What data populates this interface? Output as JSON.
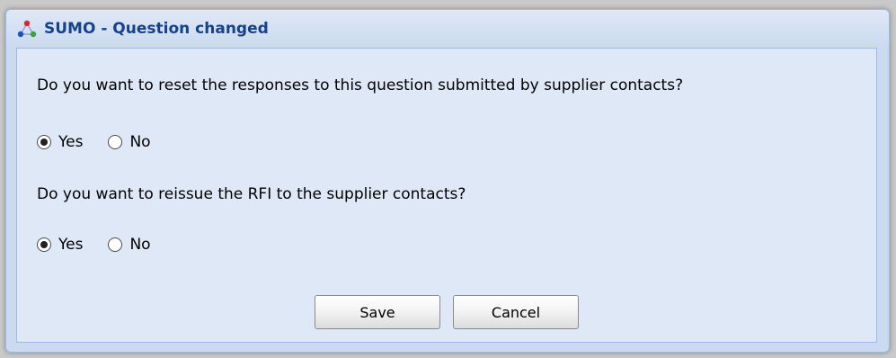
{
  "dialog": {
    "title": "SUMO - Question changed",
    "icon": "sumo-logo-icon",
    "accent_color": "#15428b",
    "questions": [
      {
        "text": "Do you want to reset the responses to this question submitted by supplier contacts?",
        "options": [
          {
            "label": "Yes",
            "selected": true
          },
          {
            "label": "No",
            "selected": false
          }
        ]
      },
      {
        "text": "Do you want to reissue the RFI to the supplier contacts?",
        "options": [
          {
            "label": "Yes",
            "selected": true
          },
          {
            "label": "No",
            "selected": false
          }
        ]
      }
    ],
    "buttons": {
      "save_label": "Save",
      "cancel_label": "Cancel"
    }
  }
}
